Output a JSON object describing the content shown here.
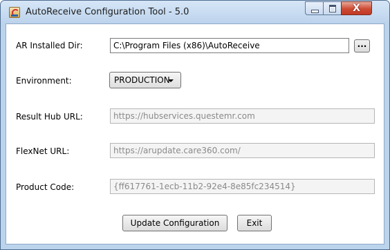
{
  "window": {
    "title": "AutoReceive Configuration Tool - 5.0",
    "controls": {
      "close_glyph": "X"
    }
  },
  "form": {
    "ar_installed_dir": {
      "label": "AR Installed Dir:",
      "value": "C:\\Program Files (x86)\\AutoReceive",
      "browse_label": "..."
    },
    "environment": {
      "label": "Environment:",
      "selected": "PRODUCTION"
    },
    "result_hub_url": {
      "label": "Result Hub URL:",
      "value": "https://hubservices.questemr.com"
    },
    "flexnet_url": {
      "label": "FlexNet URL:",
      "value": "https://arupdate.care360.com/"
    },
    "product_code": {
      "label": "Product Code:",
      "value": "{ff617761-1ecb-11b2-92e4-8e85fc234514}"
    }
  },
  "buttons": {
    "update_label": "Update Configuration",
    "exit_label": "Exit"
  },
  "icons": {
    "app": "java-coffee-cup-icon",
    "minimize": "minimize-icon",
    "maximize": "maximize-icon",
    "close": "close-icon",
    "dropdown": "chevron-down-icon"
  }
}
